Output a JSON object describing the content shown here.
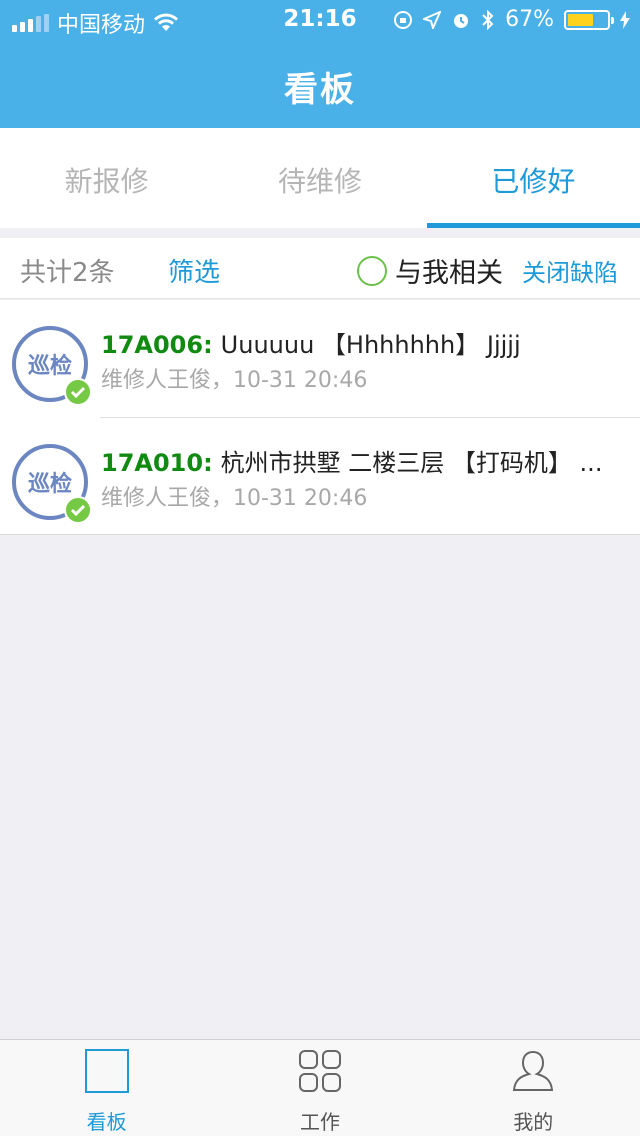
{
  "status_bar": {
    "carrier": "中国移动",
    "time": "21:16",
    "battery": "67%",
    "battery_level": 0.67
  },
  "header": {
    "title": "看板"
  },
  "tabs": [
    {
      "label": "新报修",
      "active": false
    },
    {
      "label": "待维修",
      "active": false
    },
    {
      "label": "已修好",
      "active": true
    }
  ],
  "filter_bar": {
    "total": "共计2条",
    "filter_label": "筛选",
    "related_label": "与我相关",
    "close_defect_label": "关闭缺陷"
  },
  "items": [
    {
      "avatar_text": "巡检",
      "code": "17A006:",
      "description": "Uuuuuu 【Hhhhhhh】 Jjjjj",
      "meta": "维修人王俊，10-31 20:46"
    },
    {
      "avatar_text": "巡检",
      "code": "17A010:",
      "description": "杭州市拱墅 二楼三层 【打码机】 ...",
      "meta": "维修人王俊，10-31 20:46"
    }
  ],
  "bottom_nav": [
    {
      "label": "看板",
      "icon": "board-icon",
      "active": true
    },
    {
      "label": "工作",
      "icon": "grid-icon",
      "active": false
    },
    {
      "label": "我的",
      "icon": "user-icon",
      "active": false
    }
  ],
  "colors": {
    "header_bg": "#4ab0e8",
    "accent": "#1e9ad8",
    "code_green": "#118a11",
    "check_green": "#76c945",
    "avatar_blue": "#6b86c1"
  }
}
